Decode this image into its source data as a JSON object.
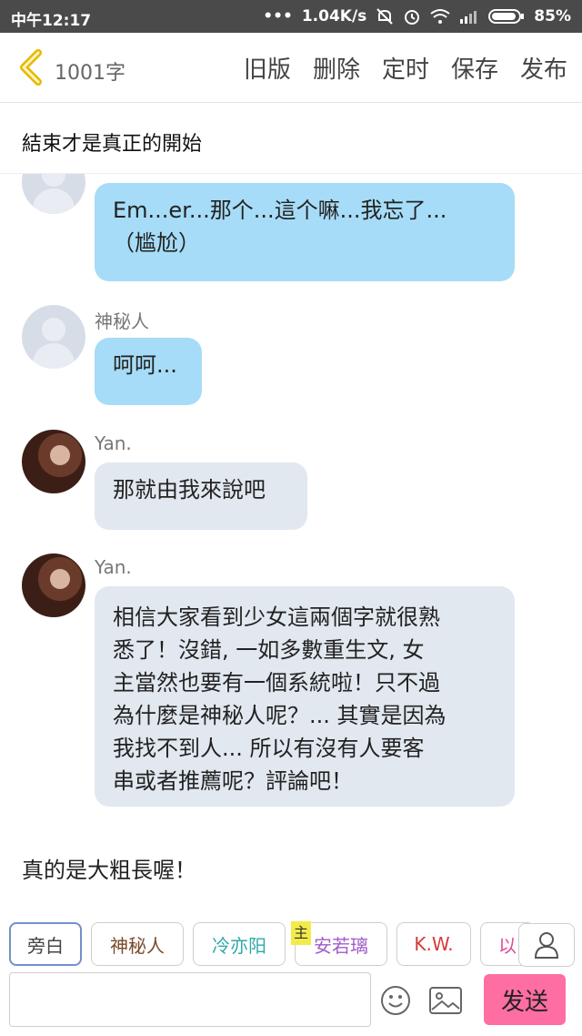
{
  "status_bar": {
    "time": "中午12:17",
    "dots": "•••",
    "speed": "1.04K/s",
    "battery": "85%"
  },
  "toolbar": {
    "word_count": "1001字",
    "actions": [
      "旧版",
      "删除",
      "定时",
      "保存",
      "发布"
    ]
  },
  "chapter_title": "結束才是真正的開始",
  "messages": [
    {
      "speaker": "",
      "text_lines": [
        "Em...er...那个...這个嘛...我忘了...",
        "（尴尬）"
      ]
    },
    {
      "speaker": "神秘人",
      "text": "呵呵..."
    },
    {
      "speaker": "Yan.",
      "text": "那就由我來說吧"
    },
    {
      "speaker": "Yan.",
      "text_lines": [
        "相信大家看到少女這兩個字就很熟",
        "悉了！沒錯, 一如多數重生文, 女",
        "主當然也要有一個系統啦！只不過",
        "為什麼是神秘人呢？... 其實是因為",
        "我找不到人... 所以有沒有人要客",
        "串或者推薦呢？評論吧！"
      ]
    }
  ],
  "narration": "真的是大粗長喔！",
  "characters": [
    {
      "label": "旁白",
      "color": "#444444",
      "selected": true
    },
    {
      "label": "神秘人",
      "color": "#7a4a2a"
    },
    {
      "label": "冷亦阳",
      "color": "#2fa9a6"
    },
    {
      "label": "安若璃",
      "color": "#a05cc8",
      "main_badge": "主"
    },
    {
      "label": "K.W.",
      "color": "#d63a3a"
    },
    {
      "label": "以",
      "color": "#e04e9c"
    }
  ],
  "input": {
    "placeholder": ""
  },
  "send_label": "发送"
}
